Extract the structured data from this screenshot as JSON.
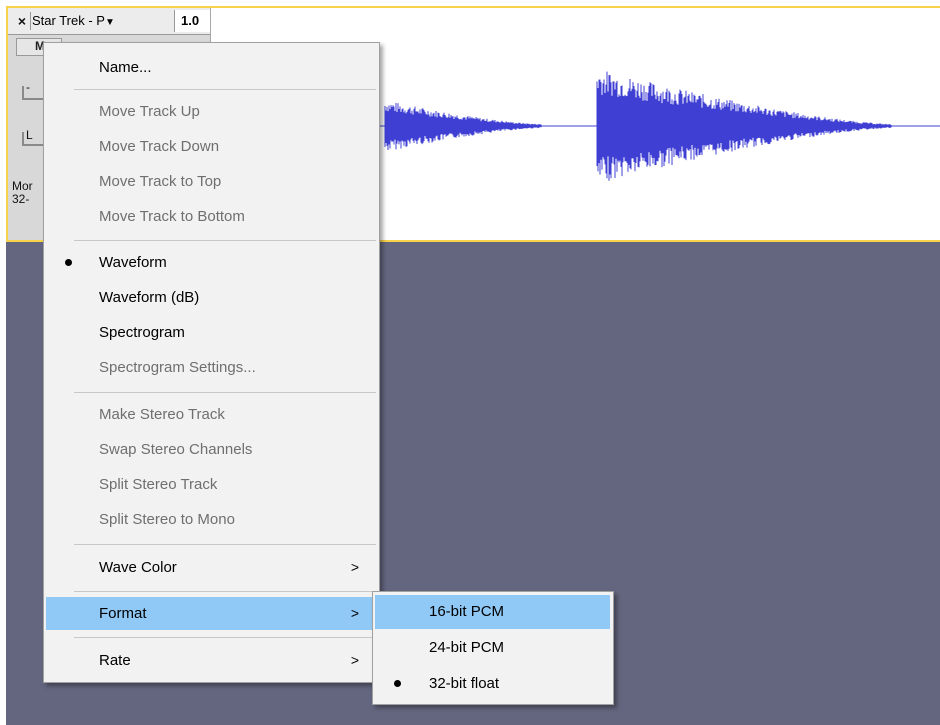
{
  "track": {
    "close_label": "×",
    "name": "Star Trek - P",
    "dropdown_arrow": "▼",
    "scale_value": "1.0",
    "mute_label": "M",
    "gain_mark": "-",
    "pan_mark": "L",
    "info_line1": "Mor",
    "info_line2": "32-",
    "border_color": "#f7d24b",
    "waveform_color": "#3f3fd4"
  },
  "menu": {
    "name": "Name...",
    "move_up": "Move Track Up",
    "move_down": "Move Track Down",
    "move_top": "Move Track to Top",
    "move_bottom": "Move Track to Bottom",
    "waveform": "Waveform",
    "waveform_db": "Waveform (dB)",
    "spectrogram": "Spectrogram",
    "spectrogram_settings": "Spectrogram Settings...",
    "make_stereo": "Make Stereo Track",
    "swap_stereo": "Swap Stereo Channels",
    "split_stereo": "Split Stereo Track",
    "split_mono": "Split Stereo to Mono",
    "wave_color": "Wave Color",
    "format": "Format",
    "rate": "Rate",
    "submenu_arrow": ">",
    "highlight_color": "#90c8f6"
  },
  "format_submenu": {
    "pcm16": "16-bit PCM",
    "pcm24": "24-bit PCM",
    "float32": "32-bit float"
  }
}
